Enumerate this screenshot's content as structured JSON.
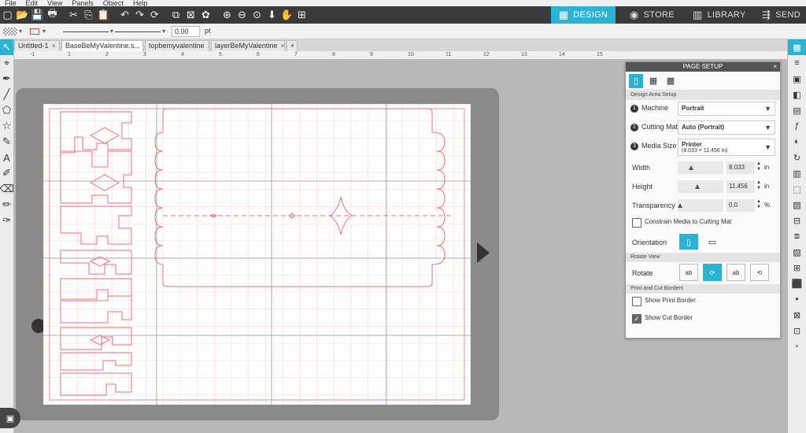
{
  "menu": [
    "File",
    "Edit",
    "View",
    "Panels",
    "Object",
    "Help"
  ],
  "toolbar": {
    "icons": [
      "new-file-icon",
      "open-icon",
      "save-icon",
      "print-icon",
      "cut-icon",
      "copy-icon",
      "paste-icon",
      "undo-icon",
      "redo-icon",
      "replicate-icon",
      "group-icon",
      "ungroup-icon",
      "weld-icon",
      "zoom-in-icon",
      "zoom-out-icon",
      "zoom-fit-icon",
      "move-down-icon",
      "pan-icon",
      "fit-page-icon"
    ],
    "glyphs": [
      "▢",
      "📂",
      "💾",
      "🖶",
      "✂",
      "⎘",
      "📋",
      "↶",
      "↷",
      "⟳",
      "⧉",
      "⊠",
      "✿",
      "⊕",
      "⊖",
      "⊙",
      "⬇",
      "✋",
      "⊞"
    ]
  },
  "nav": {
    "design": "DESIGN",
    "store": "STORE",
    "library": "LIBRARY",
    "send": "SEND"
  },
  "propbar": {
    "line_width": "0.00",
    "unit": "pt"
  },
  "tabs": [
    {
      "label": "Untitled-1",
      "active": false
    },
    {
      "label": "BaseBeMyValentine.s...",
      "active": true
    },
    {
      "label": "topbemyvalentine",
      "active": false
    },
    {
      "label": "layerBeMyValentine",
      "active": false
    }
  ],
  "tab_add": "+",
  "tab_close": "×",
  "ruler": [
    "-1",
    "1",
    "2",
    "3",
    "4",
    "5",
    "6",
    "7",
    "8",
    "9",
    "10",
    "11",
    "12",
    "13",
    "14",
    "15"
  ],
  "left_tools": [
    "↖",
    "⌖",
    "✒",
    "╱",
    "⬠",
    "☆",
    "✎",
    "A",
    "✐",
    "⌫",
    "✏",
    "✑"
  ],
  "right_tools": [
    "▦",
    "≡",
    "▣",
    "◧",
    "▤",
    "ƒ",
    "◐",
    "↻",
    "▥",
    "⬚",
    "▧",
    "⊟",
    "⧈",
    "▨",
    "⊞",
    "⬛",
    "▪",
    "⊠",
    "⊡",
    "▫"
  ],
  "panel": {
    "title": "PAGE SETUP",
    "close": "×",
    "tabs": [
      "▯",
      "▦",
      "▩"
    ],
    "section_design": "Design Area Setup",
    "machine_label": "Machine",
    "machine_value": "Portrait",
    "cutting_mat_label": "Cutting Mat",
    "cutting_mat_value": "Auto (Portrait)",
    "media_size_label": "Media Size",
    "media_size_value": "Printer",
    "media_size_dims": "(8.033 × 11.456 in)",
    "width_label": "Width",
    "width_value": "8.033",
    "height_label": "Height",
    "height_value": "11.456",
    "transparency_label": "Transparency",
    "transparency_value": "0.0",
    "unit_in": "in",
    "unit_pct": "%",
    "constrain_label": "Constrain Media to Cutting Mat",
    "orientation_label": "Orientation",
    "section_rotate": "Rotate View",
    "rotate_label": "Rotate",
    "rotate_options": [
      "ab",
      "⟳",
      "ab",
      "⟲"
    ],
    "section_borders": "Print and Cut Borders",
    "show_print_border": "Show Print Border",
    "show_cut_border": "Show Cut Border",
    "show_print_border_checked": false,
    "show_cut_border_checked": true
  },
  "colors": {
    "accent": "#2bb3d6",
    "cut_line": "#e8707a",
    "toolbar_bg": "#3a3a3a"
  }
}
